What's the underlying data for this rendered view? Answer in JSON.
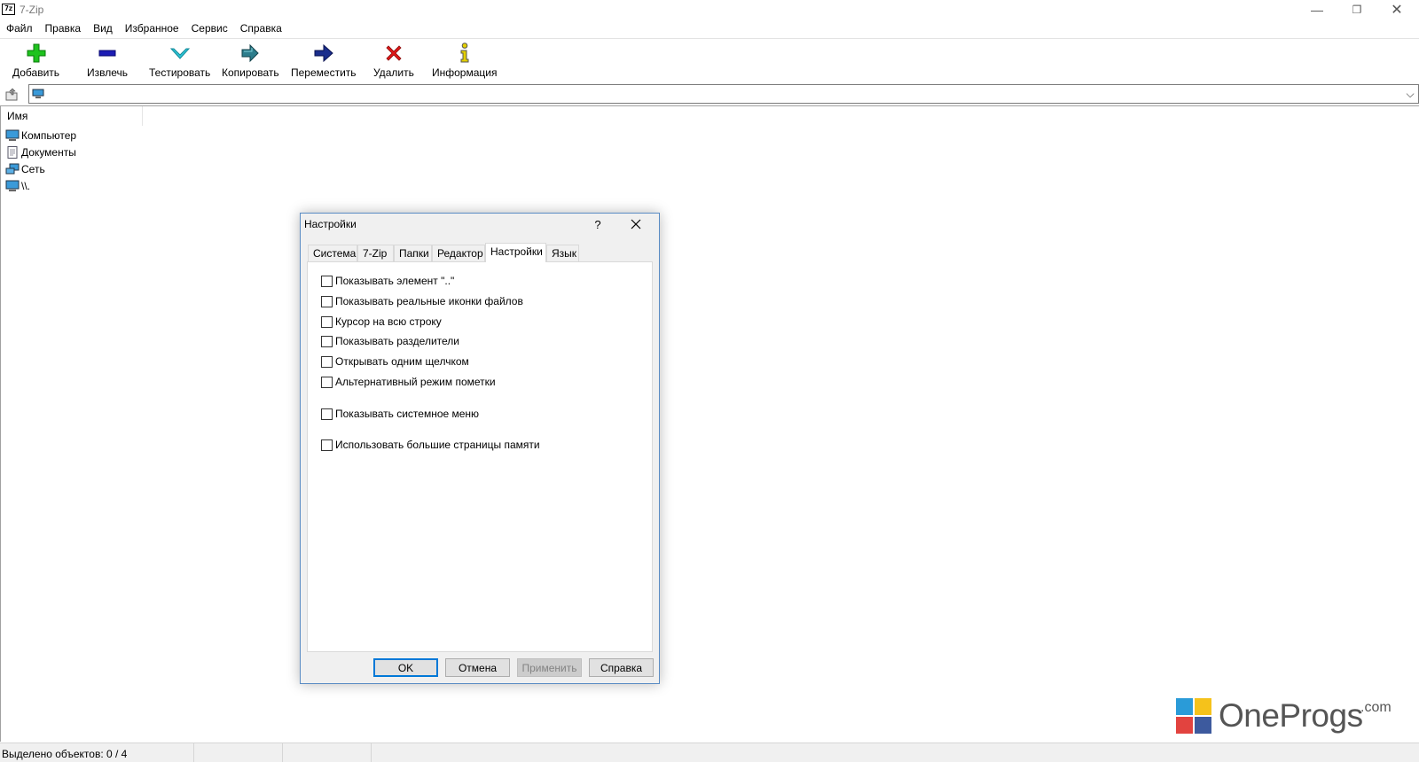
{
  "window": {
    "app_icon_text": "7z",
    "title": "7-Zip",
    "minimize_glyph": "—",
    "maximize_glyph": "❐",
    "close_glyph": "✕"
  },
  "menu": [
    "Файл",
    "Правка",
    "Вид",
    "Избранное",
    "Сервис",
    "Справка"
  ],
  "toolbar": {
    "add": "Добавить",
    "extract": "Извлечь",
    "test": "Тестировать",
    "copy": "Копировать",
    "move": "Переместить",
    "delete": "Удалить",
    "info": "Информация"
  },
  "address": {
    "path": "",
    "dropdown_glyph": "⌵"
  },
  "filelist": {
    "column_name": "Имя",
    "items": [
      "Компьютер",
      "Документы",
      "Сеть",
      "\\\\."
    ]
  },
  "status": {
    "selected": "Выделено объектов: 0 / 4"
  },
  "watermark": {
    "name": "OneProgs",
    "suffix": ".com"
  },
  "dialog": {
    "title": "Настройки",
    "help_glyph": "?",
    "tabs": [
      "Система",
      "7-Zip",
      "Папки",
      "Редактор",
      "Настройки",
      "Язык"
    ],
    "active_tab": "Настройки",
    "options": [
      {
        "label": "Показывать элемент \"..\"",
        "checked": false
      },
      {
        "label": "Показывать реальные иконки файлов",
        "checked": false
      },
      {
        "label": "Курсор на всю строку",
        "checked": false
      },
      {
        "label": "Показывать разделители",
        "checked": false
      },
      {
        "label": "Открывать одним щелчком",
        "checked": false
      },
      {
        "label": "Альтернативный режим пометки",
        "checked": false
      },
      {
        "label": "Показывать системное меню",
        "checked": false
      },
      {
        "label": "Использовать большие страницы памяти",
        "checked": false
      }
    ],
    "buttons": {
      "ok": "OK",
      "cancel": "Отмена",
      "apply": "Применить",
      "help": "Справка"
    }
  },
  "colors": {
    "accent": "#0078d7",
    "dialog_border": "#5a8cc4",
    "add_icon": "#1ec31e",
    "extract_icon": "#1c1cb4",
    "test_icon": "#2ec6d8",
    "copy_icon": "#2d7d8c",
    "move_icon": "#1a2d8c",
    "delete_icon": "#e01818",
    "info_icon": "#e4d000"
  }
}
